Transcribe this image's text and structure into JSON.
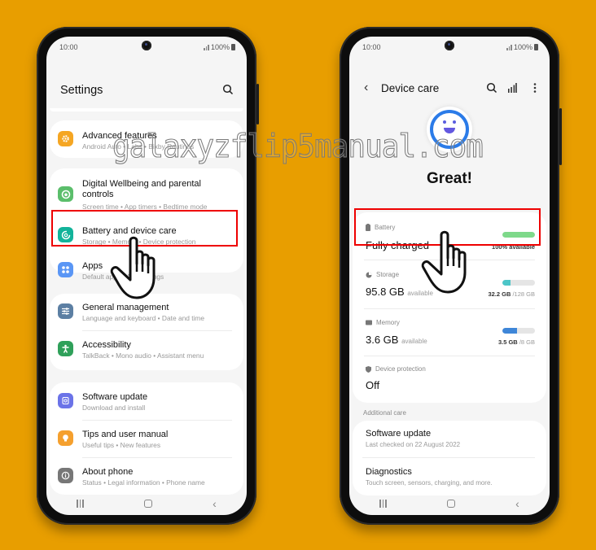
{
  "watermark": "galaxyzflip5manual.com",
  "status_bar": {
    "time": "10:00",
    "battery": "100%"
  },
  "left_screen": {
    "title": "Settings",
    "search_icon": "search-icon",
    "items": [
      {
        "title": "Advanced features",
        "subtitle": "Android Auto  •  Labs  •  Bixby Routines",
        "icon": "gear-icon",
        "color": "#F5A623"
      },
      {
        "title": "Digital Wellbeing and parental controls",
        "subtitle": "Screen time  •  App timers  •  Bedtime mode",
        "icon": "wellbeing-icon",
        "color": "#5BBE6B"
      },
      {
        "title": "Battery and device care",
        "subtitle": "Storage  •  Memory  •  Device protection",
        "icon": "device-care-icon",
        "color": "#12B39A",
        "highlighted": true
      },
      {
        "title": "Apps",
        "subtitle": "Default apps  •  App settings",
        "icon": "apps-icon",
        "color": "#5A96F5"
      },
      {
        "title": "General management",
        "subtitle": "Language and keyboard  •  Date and time",
        "icon": "sliders-icon",
        "color": "#5C7FA3"
      },
      {
        "title": "Accessibility",
        "subtitle": "TalkBack  •  Mono audio  •  Assistant menu",
        "icon": "accessibility-icon",
        "color": "#2FA05A"
      },
      {
        "title": "Software update",
        "subtitle": "Download and install",
        "icon": "update-icon",
        "color": "#6B73E8"
      },
      {
        "title": "Tips and user manual",
        "subtitle": "Useful tips  •  New features",
        "icon": "bulb-icon",
        "color": "#F5A02E"
      },
      {
        "title": "About phone",
        "subtitle": "Status  •  Legal information  •  Phone name",
        "icon": "info-icon",
        "color": "#777777"
      }
    ]
  },
  "right_screen": {
    "title": "Device care",
    "status_text": "Great!",
    "battery": {
      "label": "Battery",
      "value": "Fully charged",
      "caption": "100% available",
      "fill": 1.0,
      "color": "#7ED98A"
    },
    "storage": {
      "label": "Storage",
      "value": "95.8 GB",
      "unit": "available",
      "used": "32.2 GB",
      "total": "/128 GB",
      "fill": 0.25,
      "color": "#4CC6C8"
    },
    "memory": {
      "label": "Memory",
      "value": "3.6 GB",
      "unit": "available",
      "used": "3.5 GB",
      "total": "/8 GB",
      "fill": 0.44,
      "color": "#3E86D8"
    },
    "protection": {
      "label": "Device protection",
      "value": "Off"
    },
    "additional_header": "Additional care",
    "additional": [
      {
        "title": "Software update",
        "subtitle": "Last checked on 22 August 2022"
      },
      {
        "title": "Diagnostics",
        "subtitle": "Touch screen, sensors, charging, and more."
      }
    ]
  }
}
